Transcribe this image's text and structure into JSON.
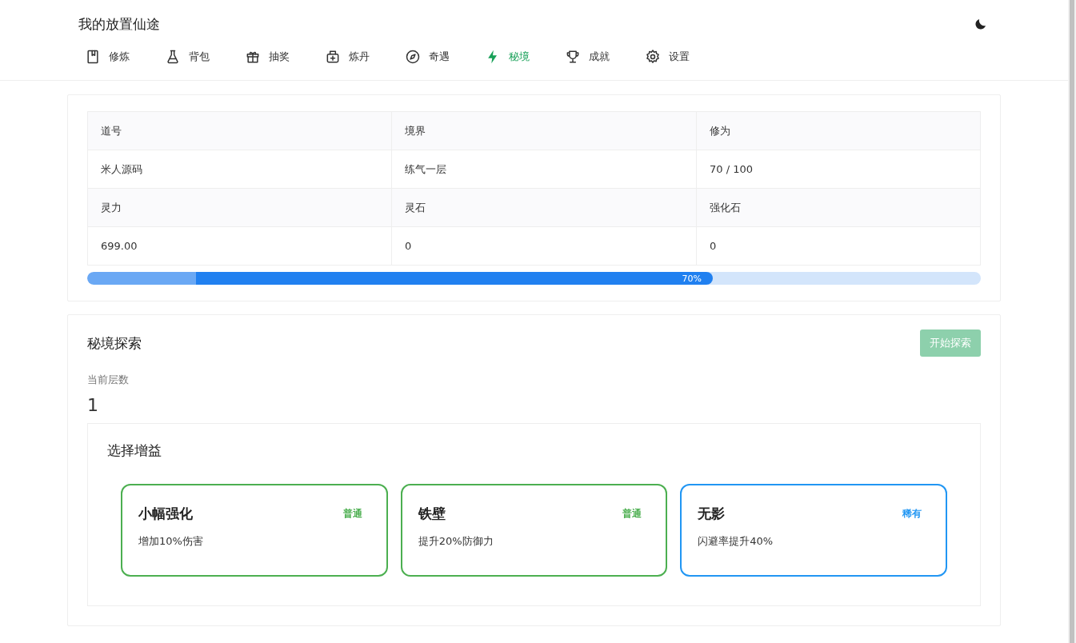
{
  "header": {
    "title": "我的放置仙途"
  },
  "tabs": [
    {
      "label": "修炼",
      "selected": false
    },
    {
      "label": "背包",
      "selected": false
    },
    {
      "label": "抽奖",
      "selected": false
    },
    {
      "label": "炼丹",
      "selected": false
    },
    {
      "label": "奇遇",
      "selected": false
    },
    {
      "label": "秘境",
      "selected": true
    },
    {
      "label": "成就",
      "selected": false
    },
    {
      "label": "设置",
      "selected": false
    }
  ],
  "stats": {
    "rows": [
      [
        "道号",
        "境界",
        "修为"
      ],
      [
        "米人源码",
        "练气一层",
        "70 / 100"
      ],
      [
        "灵力",
        "灵石",
        "强化石"
      ],
      [
        "699.00",
        "0",
        "0"
      ]
    ],
    "progress": {
      "level": 0.7,
      "label": "70%"
    }
  },
  "dungeon": {
    "title": "秘境探索",
    "button": {
      "label": "开始探索",
      "disabled": true
    },
    "floor_label": "当前层数",
    "floor": "1",
    "buffs": {
      "title": "选择增益",
      "cards": [
        {
          "name": "小幅强化",
          "rarity": "普通",
          "color": "#4caf50",
          "desc": "增加10%伤害"
        },
        {
          "name": "铁壁",
          "rarity": "普通",
          "color": "#4caf50",
          "desc": "提升20%防御力"
        },
        {
          "name": "无影",
          "rarity": "稀有",
          "color": "#2196f3",
          "desc": "闪避率提升40%"
        }
      ]
    }
  }
}
